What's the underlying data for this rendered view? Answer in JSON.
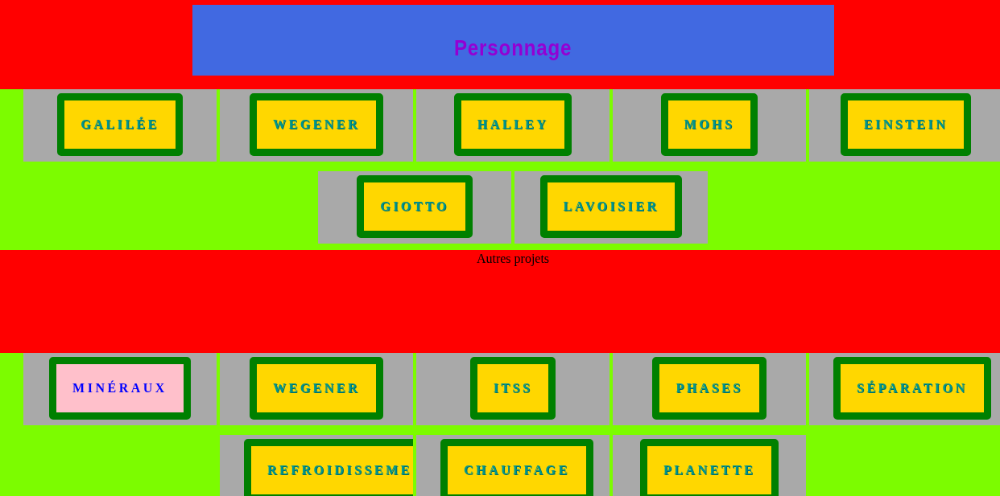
{
  "header": {
    "title": "Personnage"
  },
  "characters": [
    {
      "label": "GALILÉE",
      "selected": false
    },
    {
      "label": "WEGENER",
      "selected": false
    },
    {
      "label": "HALLEY",
      "selected": false
    },
    {
      "label": "MOHS",
      "selected": false
    },
    {
      "label": "EINSTEIN",
      "selected": false
    },
    {
      "label": "GIOTTO",
      "selected": false
    },
    {
      "label": "LAVOISIER",
      "selected": false
    }
  ],
  "section_heading": "Autres projets",
  "projects": [
    {
      "label": "MINÉRAUX",
      "selected": true
    },
    {
      "label": "WEGENER",
      "selected": false
    },
    {
      "label": "ITSS",
      "selected": false
    },
    {
      "label": "PHASES",
      "selected": false
    },
    {
      "label": "SÉPARATION",
      "selected": false
    },
    {
      "label": "REFROIDISSEME",
      "selected": false
    },
    {
      "label": "CHAUFFAGE",
      "selected": false
    },
    {
      "label": "PLANETTE",
      "selected": false
    }
  ]
}
